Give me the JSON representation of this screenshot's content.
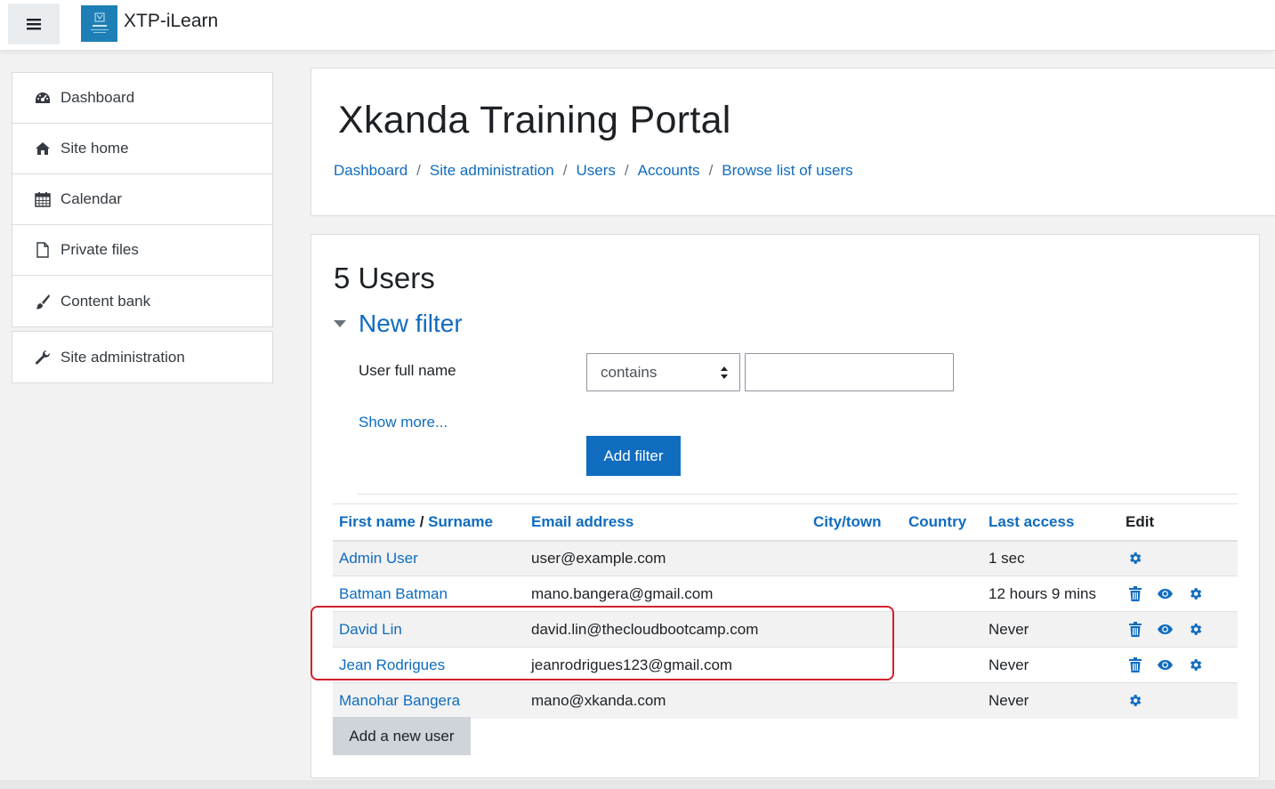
{
  "navbar": {
    "site_name": "XTP-iLearn",
    "menu_icon": "hamburger-icon",
    "logo_text": "iLearn"
  },
  "sidebar": {
    "items": [
      {
        "label": "Dashboard",
        "icon": "tachometer-icon"
      },
      {
        "label": "Site home",
        "icon": "home-icon"
      },
      {
        "label": "Calendar",
        "icon": "calendar-icon"
      },
      {
        "label": "Private files",
        "icon": "file-icon"
      },
      {
        "label": "Content bank",
        "icon": "paintbrush-icon"
      }
    ],
    "admin": {
      "label": "Site administration",
      "icon": "wrench-icon"
    }
  },
  "header": {
    "title": "Xkanda Training Portal",
    "breadcrumb": [
      "Dashboard",
      "Site administration",
      "Users",
      "Accounts",
      "Browse list of users"
    ]
  },
  "main": {
    "users_count": "5 Users",
    "filter": {
      "legend": "New filter",
      "field_label": "User full name",
      "operator_value": "contains",
      "text_value": "",
      "show_more": "Show more...",
      "add_filter_label": "Add filter"
    },
    "table": {
      "headers": {
        "first_name": "First name",
        "name_sep": " / ",
        "surname": "Surname",
        "email": "Email address",
        "city": "City/town",
        "country": "Country",
        "last_access": "Last access",
        "edit": "Edit"
      },
      "rows": [
        {
          "name": "Admin User",
          "email": "user@example.com",
          "city": "",
          "country": "",
          "last_access": "1 sec",
          "actions": [
            "cog"
          ]
        },
        {
          "name": "Batman Batman",
          "email": "mano.bangera@gmail.com",
          "city": "",
          "country": "",
          "last_access": "12 hours 9 mins",
          "actions": [
            "trash",
            "eye",
            "cog"
          ]
        },
        {
          "name": "David Lin",
          "email": "david.lin@thecloudbootcamp.com",
          "city": "",
          "country": "",
          "last_access": "Never",
          "actions": [
            "trash",
            "eye",
            "cog"
          ]
        },
        {
          "name": "Jean Rodrigues",
          "email": "jeanrodrigues123@gmail.com",
          "city": "",
          "country": "",
          "last_access": "Never",
          "actions": [
            "trash",
            "eye",
            "cog"
          ]
        },
        {
          "name": "Manohar Bangera",
          "email": "mano@xkanda.com",
          "city": "",
          "country": "",
          "last_access": "Never",
          "actions": [
            "cog"
          ]
        }
      ]
    },
    "add_user_label": "Add a new user"
  },
  "colors": {
    "link": "#0f6cbf",
    "primary_button": "#0f6cbf",
    "highlight": "#d2202c"
  }
}
